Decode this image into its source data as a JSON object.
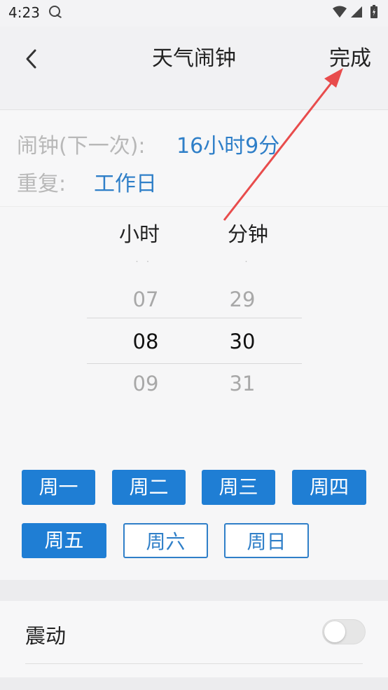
{
  "status": {
    "time": "4:23"
  },
  "header": {
    "title": "天气闹钟",
    "done_label": "完成"
  },
  "info": {
    "alarm_label": "闹钟(下一次):",
    "alarm_value": "16小时9分",
    "repeat_label": "重复:",
    "repeat_value": "工作日"
  },
  "picker": {
    "hour_header": "小时",
    "minute_header": "分钟",
    "hours": [
      "07",
      "08",
      "09"
    ],
    "minutes": [
      "29",
      "30",
      "31"
    ],
    "selected_hour": "08",
    "selected_minute": "30"
  },
  "days": [
    {
      "label": "周一",
      "selected": true
    },
    {
      "label": "周二",
      "selected": true
    },
    {
      "label": "周三",
      "selected": true
    },
    {
      "label": "周四",
      "selected": true
    },
    {
      "label": "周五",
      "selected": true
    },
    {
      "label": "周六",
      "selected": false
    },
    {
      "label": "周日",
      "selected": false
    }
  ],
  "vibration": {
    "label": "震动",
    "enabled": false
  },
  "colors": {
    "accent": "#1f7ed4",
    "annotation_arrow": "#e84c4c"
  }
}
